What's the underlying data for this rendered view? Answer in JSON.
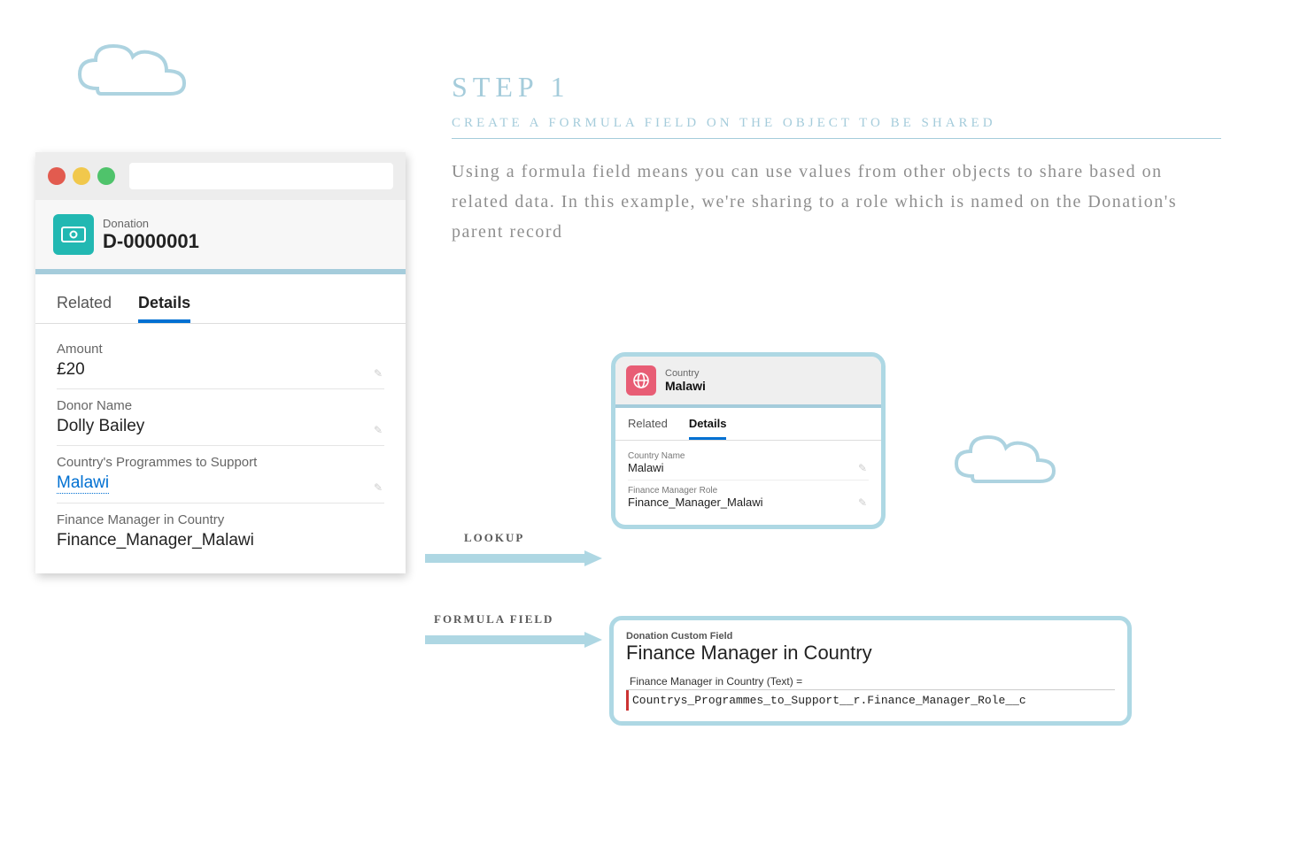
{
  "step": {
    "title": "STEP 1",
    "subtitle": "CREATE A FORMULA FIELD ON THE OBJECT TO BE SHARED",
    "description": "Using a formula field means you can use values from other objects to share based on related data. In this example, we're sharing to a role which is named on the Donation's parent record"
  },
  "colors": {
    "red": "#e25b4f",
    "yellow": "#f1c84c",
    "green": "#4fc36b",
    "accent": "#a5ccdb"
  },
  "donation": {
    "object_label": "Donation",
    "record_name": "D-0000001",
    "tabs": [
      "Related",
      "Details"
    ],
    "active_tab": "Details",
    "fields": [
      {
        "label": "Amount",
        "value": "£20",
        "link": false
      },
      {
        "label": "Donor Name",
        "value": "Dolly Bailey",
        "link": false
      },
      {
        "label": "Country's Programmes to Support",
        "value": "Malawi",
        "link": true
      },
      {
        "label": "Finance Manager in Country",
        "value": "Finance_Manager_Malawi",
        "link": false
      }
    ]
  },
  "arrows": {
    "lookup_label": "LOOKUP",
    "formula_label": "FORMULA FIELD"
  },
  "country": {
    "object_label": "Country",
    "record_name": "Malawi",
    "tabs": [
      "Related",
      "Details"
    ],
    "active_tab": "Details",
    "fields": [
      {
        "label": "Country Name",
        "value": "Malawi"
      },
      {
        "label": "Finance Manager Role",
        "value": "Finance_Manager_Malawi"
      }
    ]
  },
  "formula": {
    "meta": "Donation Custom Field",
    "title": "Finance Manager in Country",
    "eq": "Finance Manager in Country (Text) =",
    "code": "Countrys_Programmes_to_Support__r.Finance_Manager_Role__c"
  }
}
